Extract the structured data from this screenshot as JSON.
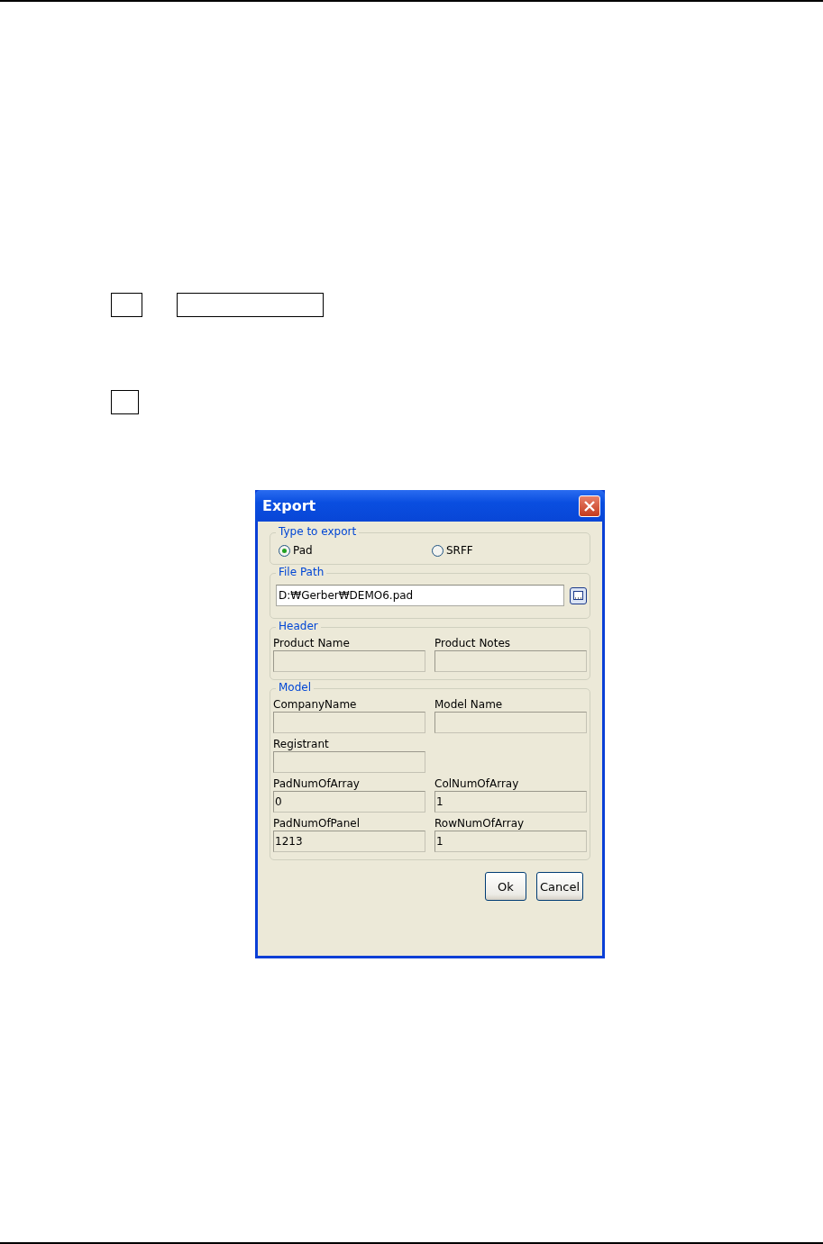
{
  "dialog": {
    "title": "Export",
    "type_group": {
      "legend": "Type to export",
      "options": [
        {
          "label": "Pad",
          "selected": true
        },
        {
          "label": "SRFF",
          "selected": false
        }
      ]
    },
    "file_path": {
      "legend": "File Path",
      "value": "D:₩Gerber₩DEMO6.pad"
    },
    "header": {
      "legend": "Header",
      "rows": [
        {
          "fields": [
            {
              "label": "Product Name"
            },
            {
              "label": "Product Notes"
            }
          ]
        }
      ]
    },
    "model": {
      "legend": "Model",
      "rows": [
        {
          "fields": [
            {
              "label": "CompanyName"
            },
            {
              "label": "Model Name"
            }
          ]
        },
        {
          "fields": [
            {
              "label": "Registrant"
            }
          ]
        },
        {
          "fields": [
            {
              "label": "PadNumOfArray",
              "value": "0"
            },
            {
              "label": "ColNumOfArray",
              "value": "1"
            }
          ]
        },
        {
          "fields": [
            {
              "label": "PadNumOfPanel",
              "value": "1213"
            },
            {
              "label": "RowNumOfArray",
              "value": "1"
            }
          ]
        }
      ]
    },
    "buttons": [
      "Ok",
      "Cancel"
    ]
  }
}
